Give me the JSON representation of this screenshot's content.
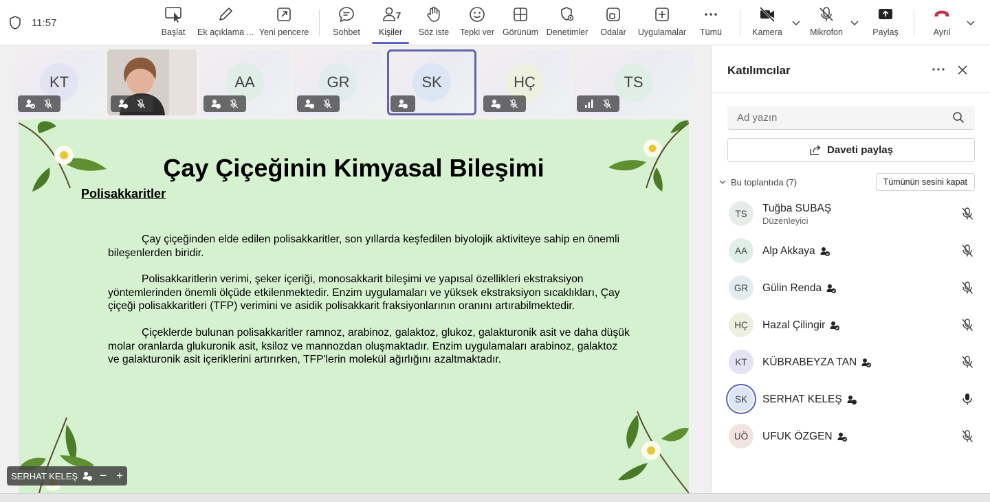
{
  "toolbar": {
    "time": "11:57",
    "buttons": {
      "start": "Başlat",
      "annotation": "Ek açıklama ...",
      "new_window": "Yeni pencere",
      "chat": "Sohbet",
      "people": "Kişiler",
      "people_count": "7",
      "raise_hand": "Söz iste",
      "react": "Tepki ver",
      "view": "Görünüm",
      "controls": "Denetimler",
      "rooms": "Odalar",
      "apps": "Uygulamalar",
      "more": "Tümü",
      "camera": "Kamera",
      "mic": "Mikrofon",
      "share": "Paylaş",
      "leave": "Ayrıl"
    },
    "colors": {
      "accent": "#5b5fc7",
      "leave_red": "#c4314b"
    }
  },
  "tiles": [
    {
      "initials": "KT",
      "avatar_bg": "#e4e3f3"
    },
    {
      "initials": "",
      "photo": true
    },
    {
      "initials": "AA",
      "avatar_bg": "#dfeee6"
    },
    {
      "initials": "GR",
      "avatar_bg": "#e2ebee"
    },
    {
      "initials": "SK",
      "avatar_bg": "#dbe5f3",
      "selected": true
    },
    {
      "initials": "HÇ",
      "avatar_bg": "#eef0df"
    },
    {
      "initials": "TS",
      "avatar_bg": "#dfeee6"
    }
  ],
  "slide": {
    "title": "Çay Çiçeğinin Kimyasal Bileşimi",
    "subtitle": "Polisakkaritler",
    "paragraphs": [
      "Çay çiçeğinden elde edilen polisakkaritler, son yıllarda keşfedilen biyolojik aktiviteye sahip en önemli bileşenlerden biridir.",
      "Polisakkaritlerin verimi, şeker içeriği, monosakkarit bileşimi ve yapısal özellikleri ekstraksiyon yöntemlerinden önemli ölçüde etkilenmektedir. Enzim uygulamaları ve yüksek ekstraksiyon sıcaklıkları, Çay çiçeği polisakkaritleri (TFP) verimini ve asidik polisakkarit fraksiyonlarının oranını artırabilmektedir.",
      "Çiçeklerde bulunan polisakkaritler ramnoz, arabinoz, galaktoz, glukoz, galakturonik asit ve daha düşük molar oranlarda glukuronik asit, ksiloz ve mannozdan oluşmaktadır. Enzim uygulamaları arabinoz, galaktoz ve galakturonik asit içeriklerini artırırken, TFP'lerin molekül ağırlığını azaltmaktadır."
    ],
    "presenter_name": "SERHAT KELEŞ",
    "zoom_out": "−",
    "zoom_in": "+"
  },
  "panel": {
    "title": "Katılımcılar",
    "search_placeholder": "Ad yazın",
    "share_invite": "Daveti paylaş",
    "section_label": "Bu toplantıda (7)",
    "mute_all": "Tümünün sesini kapat",
    "participants": [
      {
        "initials": "TS",
        "name": "Tuğba SUBAŞ",
        "role": "Düzenleyici",
        "mic_on": false,
        "badge": false,
        "avatar_bg": "#e8ece9"
      },
      {
        "initials": "AA",
        "name": "Alp Akkaya",
        "role": "",
        "mic_on": false,
        "badge": true,
        "avatar_bg": "#dfeee6"
      },
      {
        "initials": "GR",
        "name": "Gülin Renda",
        "role": "",
        "mic_on": false,
        "badge": true,
        "avatar_bg": "#e2ebee"
      },
      {
        "initials": "HÇ",
        "name": "Hazal Çilingir",
        "role": "",
        "mic_on": false,
        "badge": true,
        "avatar_bg": "#eef0df"
      },
      {
        "initials": "KT",
        "name": "KÜBRABEYZA TAN",
        "role": "",
        "mic_on": false,
        "badge": true,
        "avatar_bg": "#e4e3f3"
      },
      {
        "initials": "SK",
        "name": "SERHAT KELEŞ",
        "role": "",
        "mic_on": true,
        "badge": true,
        "avatar_bg": "#dbe5f3",
        "speaking": true
      },
      {
        "initials": "UÖ",
        "name": "UFUK ÖZGEN",
        "role": "",
        "mic_on": false,
        "badge": true,
        "avatar_bg": "#f1e4e0"
      }
    ]
  },
  "icons": {
    "shield": "shield-icon",
    "start": "screen-pointer-icon",
    "annotation": "pen-icon",
    "new_window": "popout-icon",
    "chat": "chat-icon",
    "people": "people-icon",
    "raise_hand": "hand-icon",
    "react": "smile-icon",
    "view": "grid-icon",
    "controls": "shield-gear-icon",
    "rooms": "rooms-icon",
    "apps": "add-app-icon",
    "more": "more-icon",
    "camera": "camera-off-icon",
    "mic": "mic-off-icon",
    "share": "share-tray-icon",
    "leave": "phone-hangup-icon"
  }
}
